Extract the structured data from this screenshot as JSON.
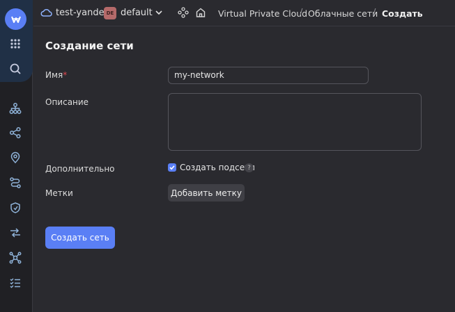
{
  "topbar": {
    "cloud_name": "test-yandex",
    "folder_badge": "DE",
    "folder_name": "default",
    "breadcrumbs": [
      "Virtual Private Cloud",
      "Облачные сети",
      "Создать"
    ],
    "separator": "/"
  },
  "sidebar": {
    "items": [
      {
        "icon": "grid-icon"
      },
      {
        "icon": "search-icon"
      },
      {
        "icon": "network-tree-icon"
      },
      {
        "icon": "share-nodes-icon"
      },
      {
        "icon": "location-pin-icon"
      },
      {
        "icon": "route-icon"
      },
      {
        "icon": "shield-icon"
      },
      {
        "icon": "arrows-exchange-icon"
      },
      {
        "icon": "hub-icon"
      },
      {
        "icon": "checklist-icon"
      }
    ]
  },
  "form": {
    "title": "Создание сети",
    "name_label": "Имя",
    "required_mark": "*",
    "name_value": "my-network",
    "description_label": "Описание",
    "description_value": "",
    "extra_label": "Дополнительно",
    "create_subnets_label": "Создать подсети",
    "create_subnets_checked": true,
    "help_glyph": "?",
    "tags_label": "Метки",
    "add_tag_button": "Добавить метку",
    "submit_button": "Создать сеть"
  },
  "colors": {
    "accent": "#5a7ff5",
    "background": "#2a2a2f",
    "sidebar": "#202024",
    "required": "#e0484f"
  }
}
